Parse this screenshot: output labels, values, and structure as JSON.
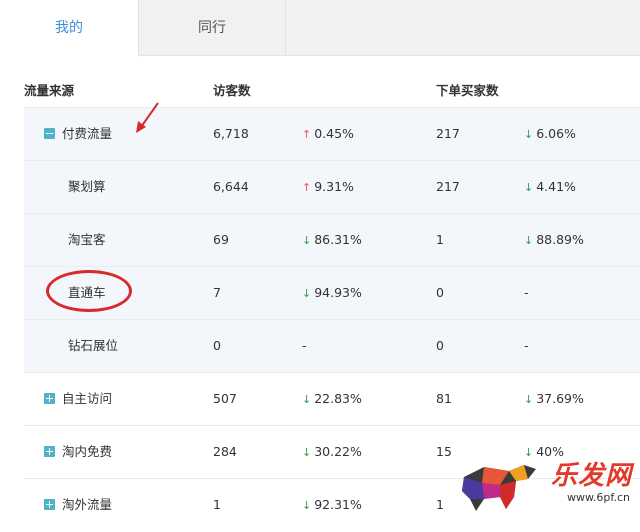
{
  "tabs": [
    {
      "label": "我的",
      "active": true
    },
    {
      "label": "同行",
      "active": false
    }
  ],
  "table": {
    "headers": {
      "source": "流量来源",
      "visitors": "访客数",
      "buyers": "下单买家数"
    },
    "rows": [
      {
        "name": "付费流量",
        "level": "top",
        "toggle": "minus",
        "visitors": "6,718",
        "v_dir": "up",
        "v_change": "0.45%",
        "buyers": "217",
        "b_dir": "down",
        "b_change": "6.06%"
      },
      {
        "name": "聚划算",
        "level": "sub",
        "visitors": "6,644",
        "v_dir": "up",
        "v_change": "9.31%",
        "buyers": "217",
        "b_dir": "down",
        "b_change": "4.41%"
      },
      {
        "name": "淘宝客",
        "level": "sub",
        "visitors": "69",
        "v_dir": "down",
        "v_change": "86.31%",
        "buyers": "1",
        "b_dir": "down",
        "b_change": "88.89%"
      },
      {
        "name": "直通车",
        "level": "sub",
        "visitors": "7",
        "v_dir": "down",
        "v_change": "94.93%",
        "buyers": "0",
        "b_dir": "none",
        "b_change": "-"
      },
      {
        "name": "钻石展位",
        "level": "sub",
        "visitors": "0",
        "v_dir": "none",
        "v_change": "-",
        "buyers": "0",
        "b_dir": "none",
        "b_change": "-"
      },
      {
        "name": "自主访问",
        "level": "top",
        "toggle": "plus",
        "visitors": "507",
        "v_dir": "down",
        "v_change": "22.83%",
        "buyers": "81",
        "b_dir": "down",
        "b_change": "37.69%"
      },
      {
        "name": "淘内免费",
        "level": "top",
        "toggle": "plus",
        "visitors": "284",
        "v_dir": "down",
        "v_change": "30.22%",
        "buyers": "15",
        "b_dir": "down",
        "b_change": "40%"
      },
      {
        "name": "淘外流量",
        "level": "top",
        "toggle": "plus",
        "visitors": "1",
        "v_dir": "down",
        "v_change": "92.31%",
        "buyers": "1",
        "b_dir": "none",
        "b_change": ""
      }
    ]
  },
  "colors": {
    "up": "#e8565a",
    "down": "#2e9e4a",
    "accent": "#3d8fd6",
    "toggle": "#4fb3c8",
    "annotation": "#d62b2b"
  },
  "watermark": {
    "title": "乐发网",
    "url": "www.6pf.cn"
  }
}
